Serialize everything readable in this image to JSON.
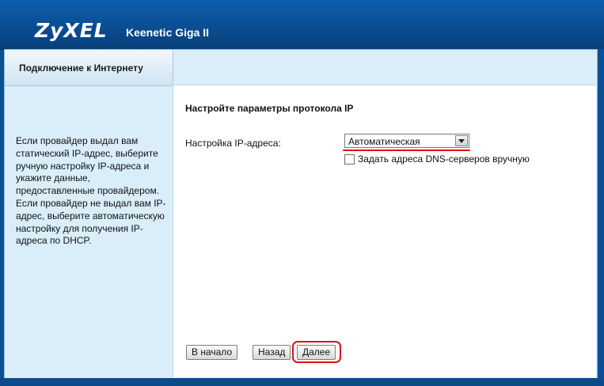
{
  "header": {
    "logo": "ZyXEL",
    "product": "Keenetic Giga II"
  },
  "tab": {
    "label": "Подключение к Интернету"
  },
  "help": {
    "text": "Если провайдер выдал вам статический IP-адрес, выберите ручную настройку IP-адреса и укажите данные, предоставленные провайдером. Если провайдер не выдал вам IP-адрес, выберите автоматическую настройку для получения IP-адреса по DHCP."
  },
  "form": {
    "title": "Настройте параметры протокола IP",
    "ip_setting_label": "Настройка IP-адреса:",
    "ip_setting_value": "Автоматическая",
    "dns_checkbox_label": "Задать адреса DNS-серверов вручную",
    "dns_checkbox_checked": false
  },
  "buttons": {
    "start": "В начало",
    "back": "Назад",
    "next": "Далее"
  },
  "colors": {
    "header_blue": "#0a4d92",
    "panel_bg": "#d9eef9",
    "highlight_red": "#dd1111"
  }
}
